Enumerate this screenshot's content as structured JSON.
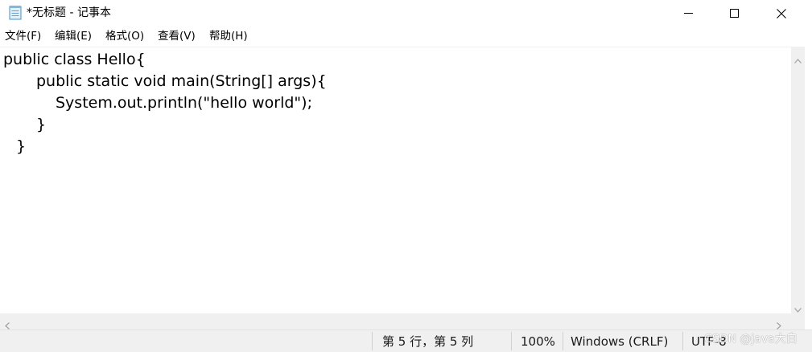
{
  "window": {
    "title": "*无标题 - 记事本"
  },
  "menu": {
    "items": [
      "文件(F)",
      "编辑(E)",
      "格式(O)",
      "查看(V)",
      "帮助(H)"
    ]
  },
  "editor": {
    "lines": [
      "public class Hello{",
      "public static void main(String[] args){",
      "System.out.println(\"hello world\");",
      "}",
      "}"
    ]
  },
  "status": {
    "position": "第 5 行，第 5 列",
    "zoom": "100%",
    "line_ending": "Windows (CRLF)",
    "encoding": "UTF-8"
  },
  "watermark": "CSDN @java大白",
  "icons": {
    "app": "notepad-icon",
    "minimize": "minimize-icon",
    "maximize": "maximize-icon",
    "close": "close-icon"
  },
  "colors": {
    "chrome_bg": "#f0f0f0",
    "editor_bg": "#ffffff",
    "text": "#000000"
  }
}
